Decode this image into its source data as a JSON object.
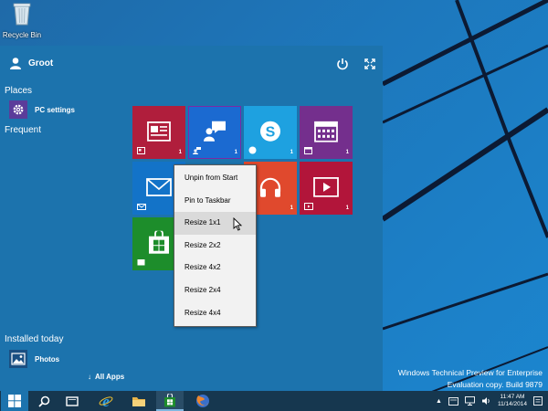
{
  "desktop": {
    "recycle_bin_label": "Recycle Bin",
    "watermark_line1": "Windows Technical Preview for Enterprise",
    "watermark_line2": "Evaluation copy. Build 9879"
  },
  "start_menu": {
    "user_name": "Groot",
    "places_heading": "Places",
    "pc_settings_label": "PC settings",
    "frequent_heading": "Frequent",
    "installed_today_heading": "Installed today",
    "photos_label": "Photos",
    "all_apps_label": "All Apps",
    "power_icon": "power-icon",
    "expand_icon": "expand-icon"
  },
  "tiles": [
    {
      "name": "news",
      "color": "#b01e3c",
      "badge": "1"
    },
    {
      "name": "people",
      "color": "#1b6ad1",
      "badge": "1"
    },
    {
      "name": "skype",
      "color": "#1ea1e0",
      "badge": "1"
    },
    {
      "name": "calendar",
      "color": "#742f8d",
      "badge": "1"
    },
    {
      "name": "mail",
      "color": "#1373c8",
      "badge": "1"
    },
    {
      "name": "music",
      "color": "#e0492d",
      "badge": "1"
    },
    {
      "name": "video",
      "color": "#b2153a",
      "badge": "1"
    },
    {
      "name": "store",
      "color": "#1d8d2b",
      "badge": ""
    }
  ],
  "context_menu": {
    "items": [
      "Unpin from Start",
      "Pin to Taskbar",
      "Resize 1x1",
      "Resize 2x2",
      "Resize 4x2",
      "Resize 2x4",
      "Resize 4x4"
    ],
    "hovered_item": "Resize 1x1"
  },
  "taskbar": {
    "clock_time": "11:47 AM",
    "clock_date": "11/14/2014",
    "apps": [
      "start",
      "search",
      "task-view",
      "internet-explorer",
      "file-explorer",
      "store",
      "firefox"
    ]
  },
  "colors": {
    "start_menu_bg": "#1c73ad",
    "taskbar_bg": "#16374f",
    "context_menu_bg": "#f2f2f2",
    "context_hover_bg": "#dadada"
  }
}
